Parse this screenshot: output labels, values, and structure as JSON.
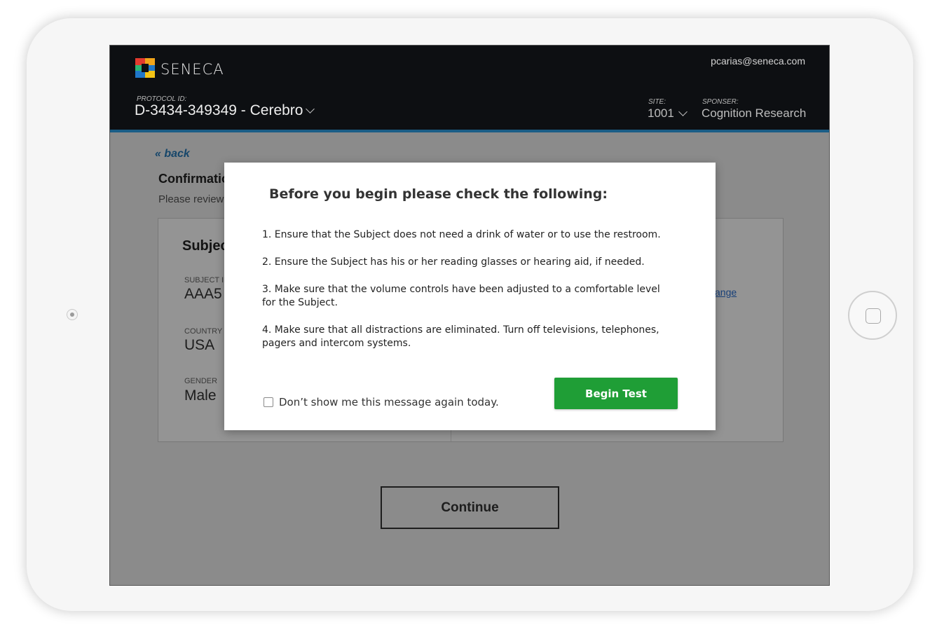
{
  "header": {
    "brand": "SENECA",
    "user_email": "pcarias@seneca.com",
    "protocol_label": "PROTOCOL ID:",
    "protocol_value": "D-3434-349349 - Cerebro",
    "site_label": "SITE:",
    "site_value": "1001",
    "sponsor_label": "SPONSER:",
    "sponsor_value": "Cognition Research"
  },
  "page": {
    "back": "« back",
    "title": "Confirmation",
    "subtitle": "Please review",
    "card_title": "Subject",
    "fields": [
      {
        "label": "SUBJECT ID",
        "value": "AAA5"
      },
      {
        "label": "COUNTRY",
        "value": "USA"
      },
      {
        "label": "GENDER",
        "value": "Male"
      }
    ],
    "change_link": "ange",
    "continue": "Continue"
  },
  "modal": {
    "title": "Before you begin please check the following:",
    "items": [
      "1. Ensure that the Subject does not need a drink of water or to use the restroom.",
      "2. Ensure the Subject has his or her reading glasses or hearing aid, if needed.",
      "3. Make sure that the volume controls have been adjusted to a comfortable level for the Subject.",
      "4. Make sure that all distractions are eliminated. Turn off televisions, telephones, pagers and intercom systems."
    ],
    "checkbox_label": "Don’t show me this message again today.",
    "begin_button": "Begin Test"
  },
  "colors": {
    "header_bg": "#0d0f12",
    "accent_blue": "#1a5d86",
    "begin_green": "#1f9e36"
  }
}
